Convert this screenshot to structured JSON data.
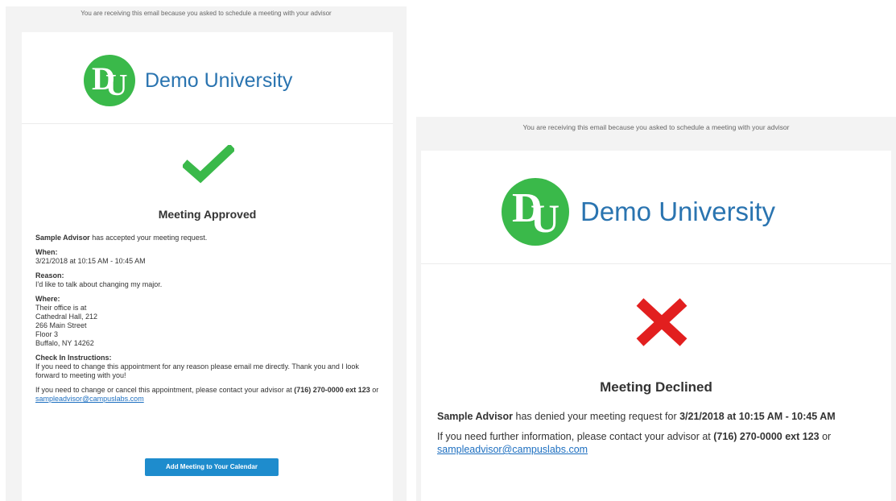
{
  "approved_email": {
    "preheader": "You are receiving this email because you asked to schedule a meeting with your advisor",
    "logo": {
      "monogram_d": "D",
      "monogram_u": "U",
      "name": "Demo University",
      "brand_color": "#3ab94a",
      "text_color": "#2a74b0"
    },
    "status_icon": "checkmark-icon",
    "status_color": "#3ab94a",
    "headline": "Meeting Approved",
    "intro_name": "Sample Advisor",
    "intro_rest": " has accepted your meeting request.",
    "when_label": "When:",
    "when_value": "3/21/2018 at 10:15 AM - 10:45 AM",
    "reason_label": "Reason:",
    "reason_value": "I'd like to talk about changing my major.",
    "where_label": "Where:",
    "where_lines": [
      "Their office is at",
      "Cathedral Hall, 212",
      "266 Main Street",
      "Floor 3",
      "Buffalo, NY 14262"
    ],
    "checkin_label": "Check In Instructions:",
    "checkin_value": "If you need to change this appointment for any reason please email me directly. Thank you and I look forward to meeting with you!",
    "contact_text": "If you need to change or cancel this appointment, please contact your advisor at ",
    "contact_phone": "(716) 270-0000 ext 123",
    "contact_or": " or ",
    "contact_email": "sampleadvisor@campuslabs.com",
    "calendar_button": "Add Meeting to Your Calendar",
    "button_color": "#1e8ccd"
  },
  "declined_email": {
    "preheader": "You are receiving this email because you asked to schedule a meeting with your advisor",
    "logo": {
      "monogram_d": "D",
      "monogram_u": "U",
      "name": "Demo University",
      "brand_color": "#3ab94a",
      "text_color": "#2a74b0"
    },
    "status_icon": "x-mark-icon",
    "status_color": "#e21f1f",
    "headline": "Meeting Declined",
    "intro_name": "Sample Advisor",
    "intro_rest": " has denied your meeting request for ",
    "intro_datetime": "3/21/2018 at 10:15 AM - 10:45 AM",
    "contact_text": "If you need further information, please contact your advisor at ",
    "contact_phone": "(716) 270-0000 ext 123",
    "contact_or": " or ",
    "contact_email": "sampleadvisor@campuslabs.com"
  }
}
